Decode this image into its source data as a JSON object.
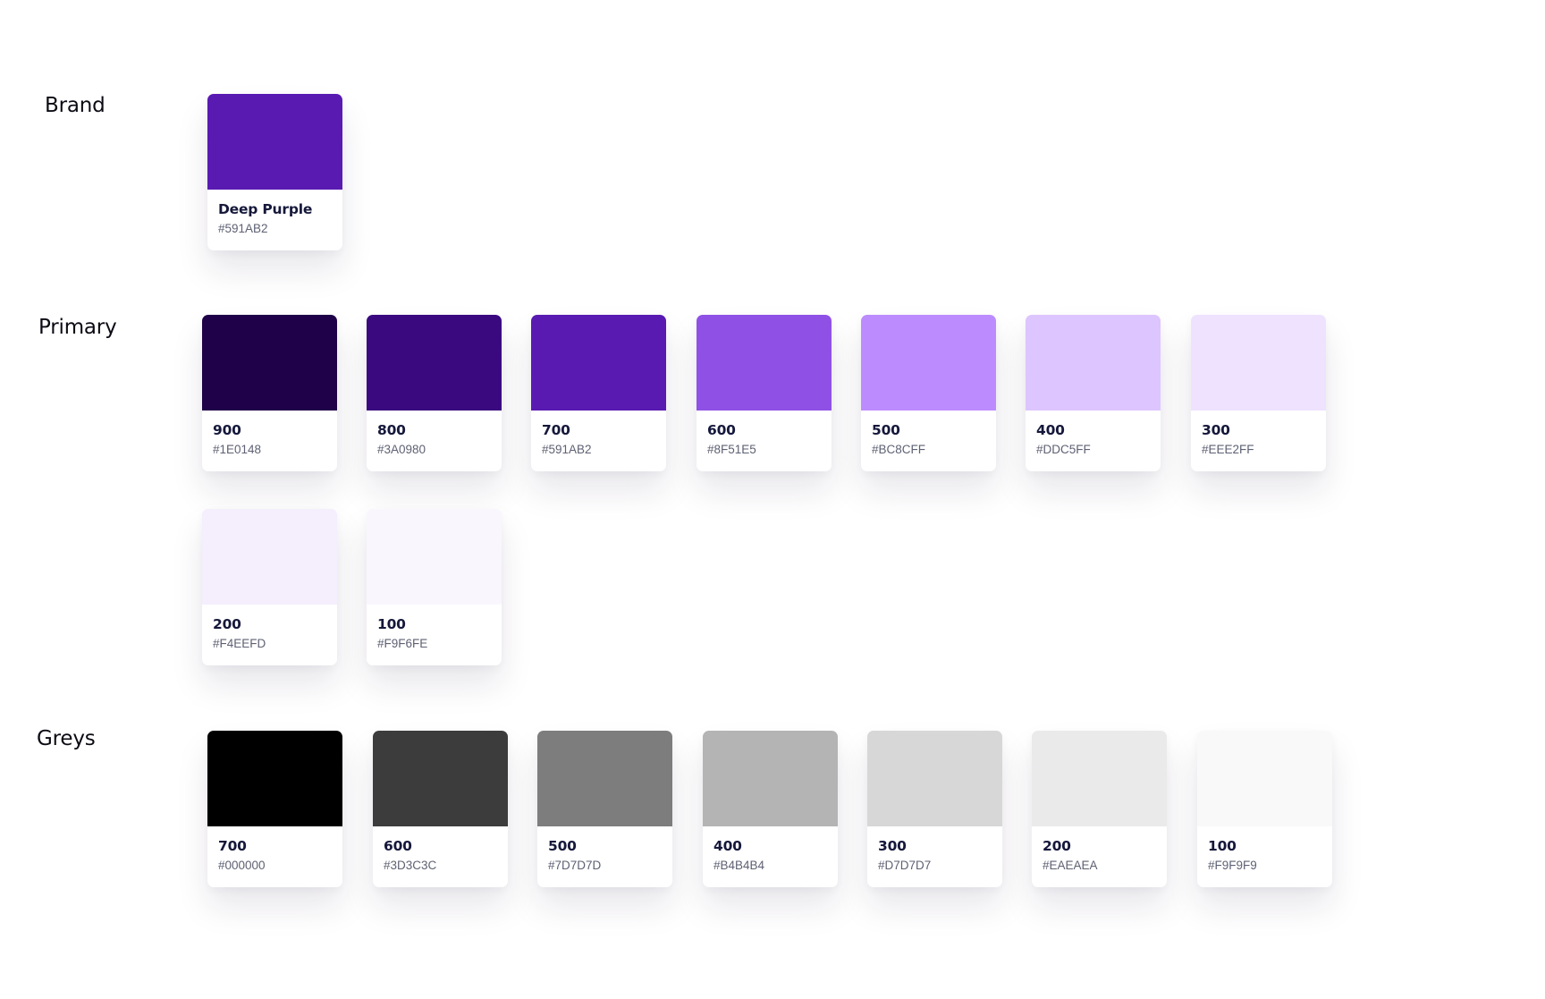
{
  "sections": {
    "brand": {
      "title": "Brand",
      "colors": [
        {
          "name": "Deep Purple",
          "hex": "#591AB2",
          "swatch": "#591AB2"
        }
      ]
    },
    "primary": {
      "title": "Primary",
      "colors": [
        {
          "name": "900",
          "hex": "#1E0148",
          "swatch": "#1E0148"
        },
        {
          "name": "800",
          "hex": "#3A0980",
          "swatch": "#3A0980"
        },
        {
          "name": "700",
          "hex": "#591AB2",
          "swatch": "#591AB2"
        },
        {
          "name": "600",
          "hex": "#8F51E5",
          "swatch": "#8F51E5"
        },
        {
          "name": "500",
          "hex": "#BC8CFF",
          "swatch": "#BC8CFF"
        },
        {
          "name": "400",
          "hex": "#DDC5FF",
          "swatch": "#DDC5FF"
        },
        {
          "name": "300",
          "hex": "#EEE2FF",
          "swatch": "#EEE2FF"
        },
        {
          "name": "200",
          "hex": "#F4EEFD",
          "swatch": "#F4EEFD"
        },
        {
          "name": "100",
          "hex": "#F9F6FE",
          "swatch": "#F9F6FE"
        }
      ]
    },
    "greys": {
      "title": "Greys",
      "colors": [
        {
          "name": "700",
          "hex": "#000000",
          "swatch": "#000000"
        },
        {
          "name": "600",
          "hex": "#3D3C3C",
          "swatch": "#3D3C3C"
        },
        {
          "name": "500",
          "hex": "#7D7D7D",
          "swatch": "#7D7D7D"
        },
        {
          "name": "400",
          "hex": "#B4B4B4",
          "swatch": "#B4B4B4"
        },
        {
          "name": "300",
          "hex": "#D7D7D7",
          "swatch": "#D7D7D7"
        },
        {
          "name": "200",
          "hex": "#EAEAEA",
          "swatch": "#EAEAEA"
        },
        {
          "name": "100",
          "hex": "#F9F9F9",
          "swatch": "#F9F9F9"
        }
      ]
    }
  }
}
